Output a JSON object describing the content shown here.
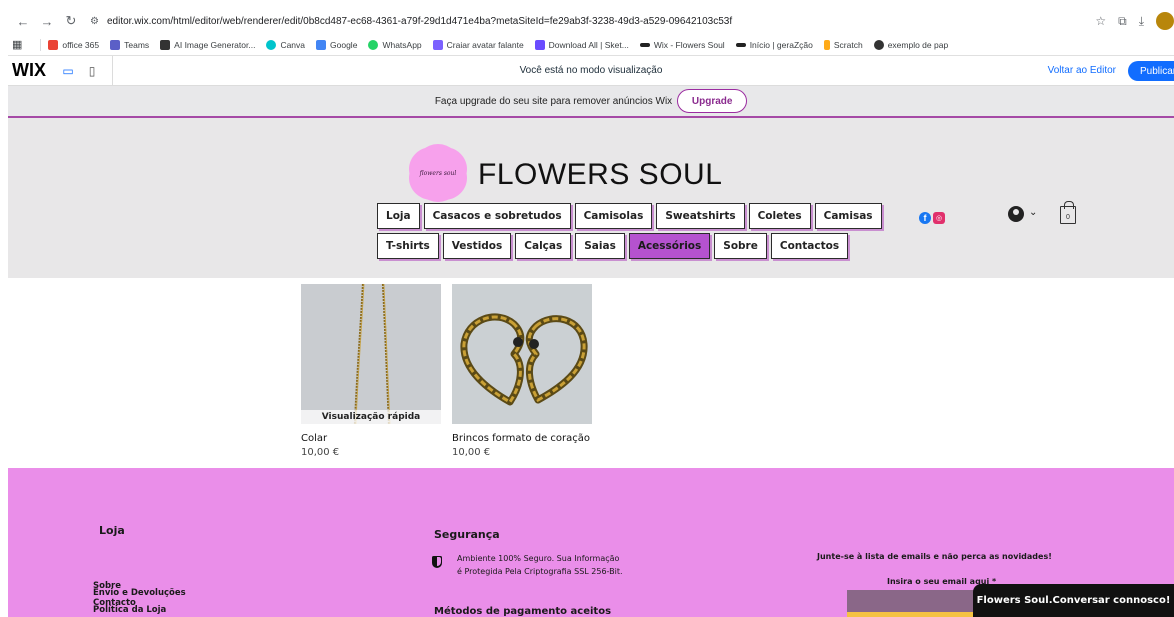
{
  "browser": {
    "url": "editor.wix.com/html/editor/web/renderer/edit/0b8cd487-ec68-4361-a79f-29d1d471e4ba?metaSiteId=fe29ab3f-3238-49d3-a529-09642103c53f",
    "bookmarks": [
      {
        "label": "office 365",
        "color": "#ea4335"
      },
      {
        "label": "Teams",
        "color": "#5b5fc7"
      },
      {
        "label": "AI Image Generator...",
        "color": "#333333"
      },
      {
        "label": "Canva",
        "color": "#00c4cc"
      },
      {
        "label": "Google",
        "color": "#4285f4"
      },
      {
        "label": "WhatsApp",
        "color": "#25d366"
      },
      {
        "label": "Craiar avatar falante",
        "color": "#7b61ff"
      },
      {
        "label": "Download All | Sket...",
        "color": "#6a4cff"
      },
      {
        "label": "Wix - Flowers Soul",
        "color": "#222222"
      },
      {
        "label": "Início | geraZção",
        "color": "#222222"
      },
      {
        "label": "Scratch",
        "color": "#ffab19"
      },
      {
        "label": "exemplo de pap",
        "color": "#333333"
      }
    ]
  },
  "wix": {
    "logo": "WIX",
    "mode_text": "Você está no modo visualização",
    "back_to_editor": "Voltar ao Editor",
    "publish": "Publicar"
  },
  "upgrade": {
    "text": "Faça upgrade do seu site para remover anúncios Wix",
    "button": "Upgrade"
  },
  "site": {
    "logo_text": "flowers soul",
    "title": "FLOWERS SOUL",
    "menu_row1": [
      "Loja",
      "Casacos e sobretudos",
      "Camisolas",
      "Sweatshirts",
      "Coletes",
      "Camisas"
    ],
    "menu_row2": [
      "T-shirts",
      "Vestidos",
      "Calças",
      "Saias",
      "Acessórios",
      "Sobre",
      "Contactos"
    ],
    "active_menu": "Acessórios",
    "cart_count": "0"
  },
  "products": [
    {
      "name": "Colar",
      "price": "10,00 €",
      "quick_view": "Visualização rápida"
    },
    {
      "name": "Brincos formato de coração",
      "price": "10,00 €"
    }
  ],
  "footer": {
    "shop_heading": "Loja",
    "links": [
      "Sobre",
      "Contacto",
      "Envio e Devoluções",
      "Política da Loja"
    ],
    "security_heading": "Segurança",
    "security_text_1": "Ambiente 100% Seguro. Sua Informação",
    "security_text_2": "é Protegida Pela Criptografia SSL 256-Bit.",
    "payment_heading": "Métodos de pagamento aceitos",
    "newsletter_text": "Junte-se à lista de emails e não perca as novidades!",
    "email_label": "Insira o seu email aqui *"
  },
  "chat": "Flowers Soul.Conversar connosco!",
  "colors": {
    "accent": "#b552cf",
    "footer_bg": "#ea8ee9",
    "wix_blue": "#116dff"
  }
}
